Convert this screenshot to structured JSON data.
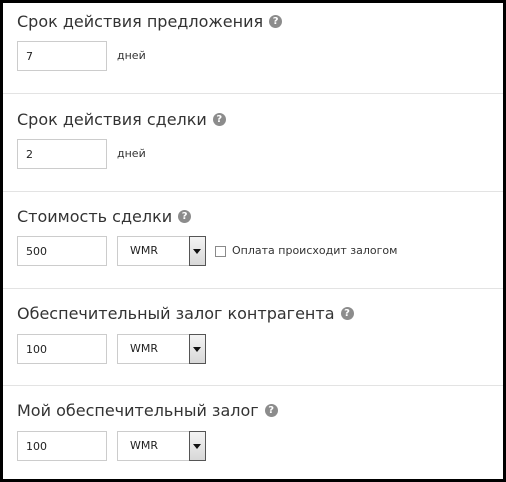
{
  "sections": [
    {
      "title": "Срок действия предложения",
      "value": "7",
      "unit": "дней"
    },
    {
      "title": "Срок действия сделки",
      "value": "2",
      "unit": "дней"
    },
    {
      "title": "Стоимость сделки",
      "value": "500",
      "currency": "WMR",
      "checkbox_label": "Оплата происходит залогом",
      "checkbox_checked": false
    },
    {
      "title": "Обеспечительный залог контрагента",
      "value": "100",
      "currency": "WMR"
    },
    {
      "title": "Мой обеспечительный залог",
      "value": "100",
      "currency": "WMR"
    }
  ],
  "help_glyph": "?",
  "colors": {
    "frame": "#000000",
    "divider": "#e3e3e3",
    "help_icon": "#8c8c8c"
  }
}
